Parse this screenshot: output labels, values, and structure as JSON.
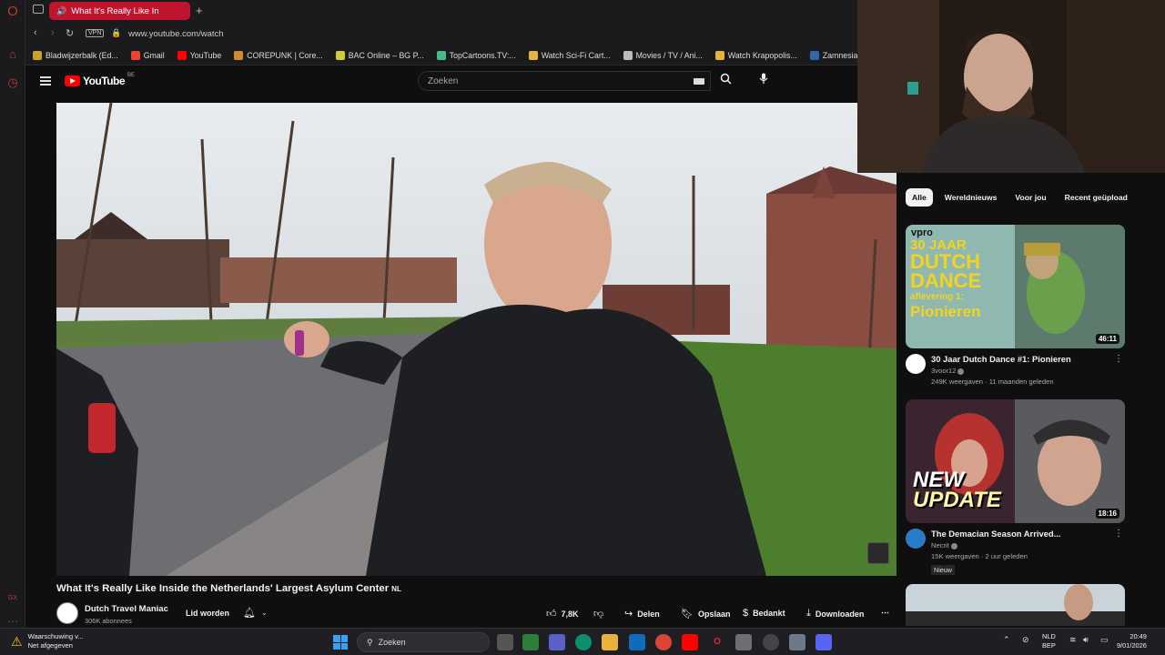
{
  "browser": {
    "tab_title": "What It's Really Like In",
    "url": "www.youtube.com/watch",
    "vpn_label": "VPN",
    "bookmarks": [
      {
        "label": "Bladwijzerbalk (Ed...",
        "icon": "folder-icon"
      },
      {
        "label": "Gmail",
        "icon": "gmail-icon"
      },
      {
        "label": "YouTube",
        "icon": "youtube-icon"
      },
      {
        "label": "COREPUNK | Core...",
        "icon": "corepunk-icon"
      },
      {
        "label": "BAC Online – BG P...",
        "icon": "bac-icon"
      },
      {
        "label": "TopCartoons.TV:...",
        "icon": "topcartoons-icon"
      },
      {
        "label": "Watch Sci-Fi Cart...",
        "icon": "scifi-icon"
      },
      {
        "label": "Movies / TV / Ani...",
        "icon": "movies-icon"
      },
      {
        "label": "Watch Krapopolis...",
        "icon": "krapopolis-icon"
      },
      {
        "label": "Zamnesia | Het Be",
        "icon": "zamnesia-icon"
      }
    ]
  },
  "youtube": {
    "logo_text": "YouTube",
    "country_code": "BE",
    "search_placeholder": "Zoeken"
  },
  "video": {
    "title": "What It's Really Like Inside the Netherlands' Largest Asylum Center",
    "title_badge": "NL",
    "channel_name": "Dutch Travel Maniac",
    "subscribers": "306K abonnees",
    "join_label": "Lid worden",
    "like_count": "7,8K",
    "share_label": "Delen",
    "save_label": "Opslaan",
    "thanks_label": "Bedankt",
    "download_label": "Downloaden"
  },
  "chips": [
    "Alle",
    "Wereldnieuws",
    "Voor jou",
    "Recent geüpload"
  ],
  "recommendations": [
    {
      "title": "30 Jaar Dutch Dance #1: Pionieren",
      "channel": "3voor12",
      "stats": "249K weergaven · 11 maanden geleden",
      "duration": "46:11",
      "badge": "",
      "thumb_text": {
        "brand": "vpro",
        "line1": "30 JAAR",
        "line2": "DUTCH",
        "line3": "DANCE",
        "line4": "aflevering 1:",
        "line5": "Pionieren"
      }
    },
    {
      "title": "The Demacian Season Arrived...",
      "channel": "Necrit",
      "stats": "15K weergaven · 2 uur geleden",
      "duration": "18:16",
      "badge": "Nieuw",
      "thumb_text": {
        "line1": "NEW",
        "line2": "UPDATE"
      }
    }
  ],
  "taskbar": {
    "warning_title": "Waarschuwing v...",
    "warning_sub": "Net afgegeven",
    "search_label": "Zoeken",
    "language_top": "NLD",
    "language_bottom": "BEP",
    "time": "20:49",
    "date": "9/01/2026"
  },
  "colors": {
    "opera_red": "#c0152f",
    "youtube_red": "#ff0000",
    "background": "#0f0f0f"
  }
}
